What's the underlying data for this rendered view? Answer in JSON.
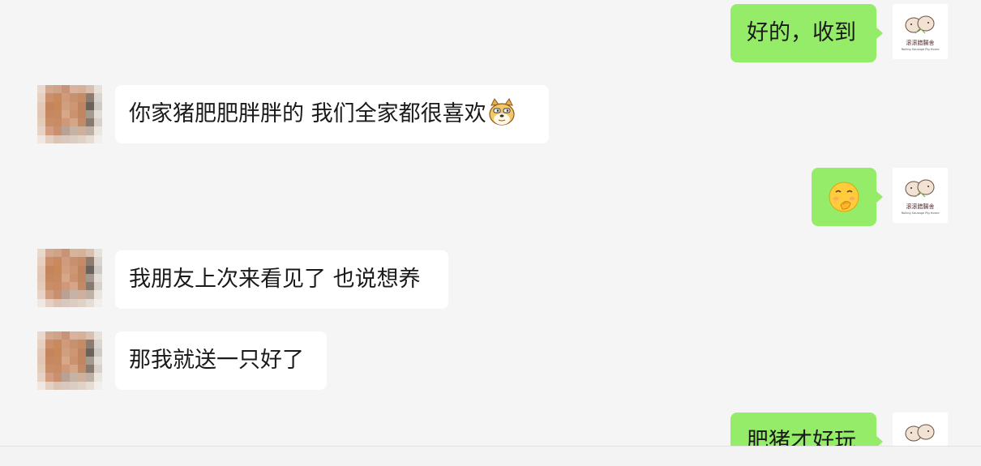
{
  "messages": [
    {
      "side": "right",
      "text": "好的，收到"
    },
    {
      "side": "left",
      "text": "你家猪肥肥胖胖的 我们全家都很喜欢",
      "emoji": "doge-face-emoji"
    },
    {
      "side": "right",
      "text": "",
      "emoji": "shy-hand-over-mouth-emoji"
    },
    {
      "side": "left",
      "text": "我朋友上次来看见了 也说想养"
    },
    {
      "side": "left",
      "text": "那我就送一只好了"
    },
    {
      "side": "right",
      "text": "肥猪才好玩"
    }
  ],
  "self_avatar": {
    "logo_text": "滚滚腊腸舍",
    "logo_subtext": "Rolling Sausage Pig Home",
    "icon": "two-piglets-logo"
  },
  "contact_avatar": {
    "icon": "pixelated-avatar"
  },
  "colors": {
    "background": "#f5f5f5",
    "self_bubble": "#95ec69",
    "other_bubble": "#ffffff",
    "text": "#1a1a1a"
  }
}
